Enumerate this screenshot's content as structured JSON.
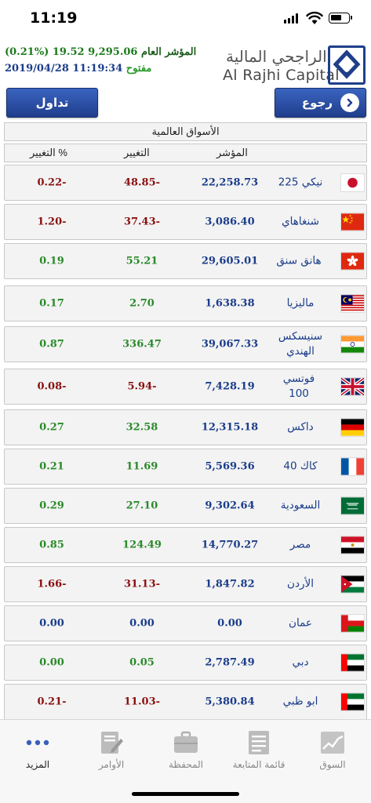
{
  "status_bar": {
    "time": "11:19"
  },
  "header": {
    "general_index_label": "المؤشر العام",
    "general_index_value": "9,295.06",
    "general_index_change": "19.52",
    "general_index_pct": "(0.21%)",
    "date_time": "2019/04/28 11:19:34",
    "market_status": "مفتوح",
    "logo_arabic": "الراجحي المالية",
    "logo_english": "Al Rajhi Capital"
  },
  "buttons": {
    "trade": "تداول",
    "back": "رجوع"
  },
  "table": {
    "title": "الأسواق العالمية",
    "columns": {
      "index": "المؤشر",
      "change": "التغيير",
      "pct_change": "التغيير %"
    },
    "rows": [
      {
        "name": "نيكي 225",
        "index": "22,258.73",
        "change": "48.85-",
        "pct": "0.22-",
        "dir": "neg",
        "flag": "japan"
      },
      {
        "name": "شنغاهاي",
        "index": "3,086.40",
        "change": "37.43-",
        "pct": "1.20-",
        "dir": "neg",
        "flag": "china"
      },
      {
        "name": "هانق سنق",
        "index": "29,605.01",
        "change": "55.21",
        "pct": "0.19",
        "dir": "pos",
        "flag": "hongkong"
      },
      {
        "name": "ماليزيا",
        "index": "1,638.38",
        "change": "2.70",
        "pct": "0.17",
        "dir": "pos",
        "flag": "malaysia"
      },
      {
        "name": "سنيسكس الهندي",
        "index": "39,067.33",
        "change": "336.47",
        "pct": "0.87",
        "dir": "pos",
        "flag": "india"
      },
      {
        "name": "فوتسي 100",
        "index": "7,428.19",
        "change": "5.94-",
        "pct": "0.08-",
        "dir": "neg",
        "flag": "uk"
      },
      {
        "name": "داكس",
        "index": "12,315.18",
        "change": "32.58",
        "pct": "0.27",
        "dir": "pos",
        "flag": "germany"
      },
      {
        "name": "كاك 40",
        "index": "5,569.36",
        "change": "11.69",
        "pct": "0.21",
        "dir": "pos",
        "flag": "france"
      },
      {
        "name": "السعودية",
        "index": "9,302.64",
        "change": "27.10",
        "pct": "0.29",
        "dir": "pos",
        "flag": "saudi"
      },
      {
        "name": "مصر",
        "index": "14,770.27",
        "change": "124.49",
        "pct": "0.85",
        "dir": "pos",
        "flag": "egypt"
      },
      {
        "name": "الأردن",
        "index": "1,847.82",
        "change": "31.13-",
        "pct": "1.66-",
        "dir": "neg",
        "flag": "jordan"
      },
      {
        "name": "عمان",
        "index": "0.00",
        "change": "0.00",
        "pct": "0.00",
        "dir": "zero",
        "flag": "oman"
      },
      {
        "name": "دبي",
        "index": "2,787.49",
        "change": "0.05",
        "pct": "0.00",
        "dir": "pos",
        "flag": "uae"
      },
      {
        "name": "ابو ظبي",
        "index": "5,380.84",
        "change": "11.03-",
        "pct": "0.21-",
        "dir": "neg",
        "flag": "uae"
      }
    ]
  },
  "tabbar": {
    "tabs": [
      {
        "label": "المزيد",
        "icon": "more-dots-icon",
        "active": true
      },
      {
        "label": "الأوامر",
        "icon": "orders-icon",
        "active": false
      },
      {
        "label": "المحفظة",
        "icon": "briefcase-icon",
        "active": false
      },
      {
        "label": "قائمة المتابعة",
        "icon": "watchlist-icon",
        "active": false
      },
      {
        "label": "السوق",
        "icon": "market-chart-icon",
        "active": false
      }
    ]
  },
  "colors": {
    "primary_blue": "#1a3c8a",
    "negative": "#8a1010",
    "positive": "#2a8a2a",
    "button_blue": "#2a4ea4"
  }
}
